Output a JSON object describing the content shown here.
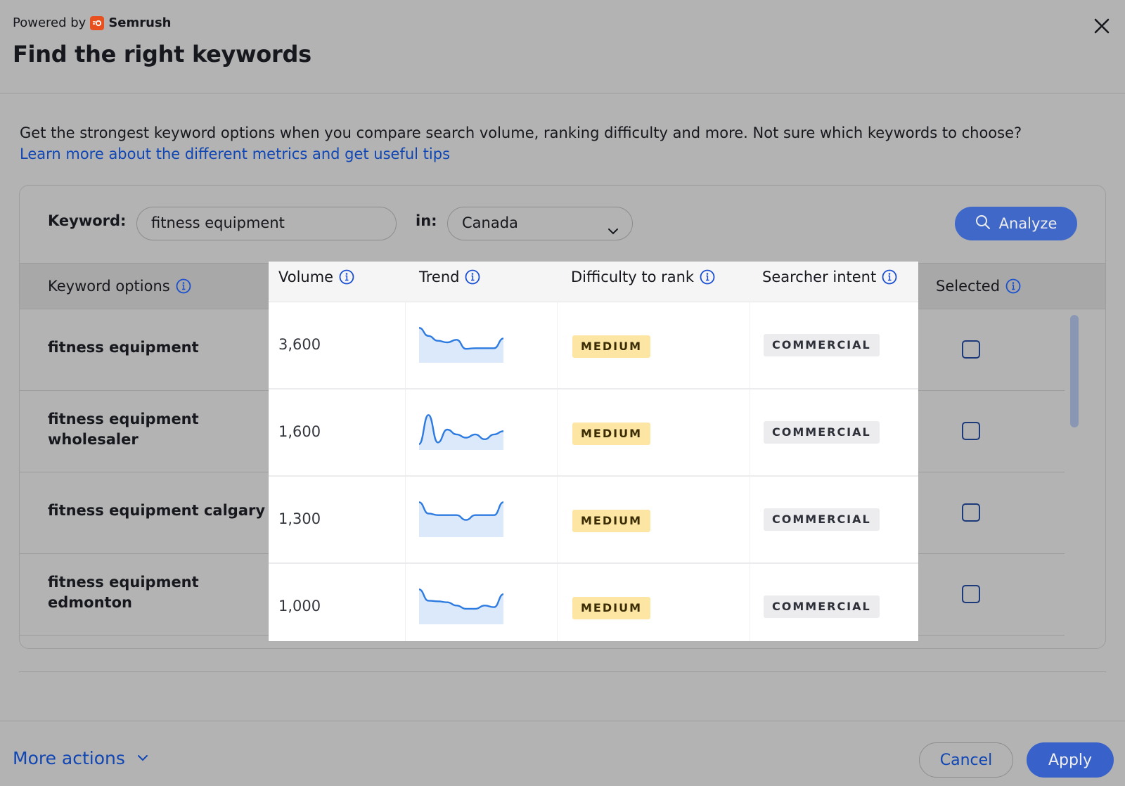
{
  "header": {
    "powered_by": "Powered by",
    "brand": "Semrush",
    "title": "Find the right keywords"
  },
  "intro": {
    "text": "Get the strongest keyword options when you compare search volume, ranking difficulty and more. Not sure which keywords to choose?",
    "link": "Learn more about the different metrics and get useful tips"
  },
  "search": {
    "keyword_label": "Keyword:",
    "keyword_value": "fitness equipment",
    "in_label": "in:",
    "country": "Canada",
    "analyze_label": "Analyze"
  },
  "columns": {
    "keyword_options": "Keyword options",
    "volume": "Volume",
    "trend": "Trend",
    "difficulty": "Difficulty to rank",
    "intent": "Searcher intent",
    "selected": "Selected"
  },
  "rows": [
    {
      "keyword": "fitness equipment",
      "volume": "3,600",
      "difficulty": "MEDIUM",
      "intent": "COMMERCIAL",
      "trend": [
        0.95,
        0.7,
        0.55,
        0.5,
        0.58,
        0.3,
        0.32,
        0.32,
        0.32,
        0.62
      ],
      "selected": false
    },
    {
      "keyword": "fitness equipment wholesaler",
      "volume": "1,600",
      "difficulty": "MEDIUM",
      "intent": "COMMERCIAL",
      "trend": [
        0.05,
        0.95,
        0.1,
        0.5,
        0.35,
        0.25,
        0.35,
        0.2,
        0.35,
        0.45
      ],
      "selected": false
    },
    {
      "keyword": "fitness equipment calgary",
      "volume": "1,300",
      "difficulty": "MEDIUM",
      "intent": "COMMERCIAL",
      "trend": [
        0.95,
        0.6,
        0.55,
        0.55,
        0.55,
        0.4,
        0.55,
        0.55,
        0.55,
        0.95
      ],
      "selected": false
    },
    {
      "keyword": "fitness equipment edmonton",
      "volume": "1,000",
      "difficulty": "MEDIUM",
      "intent": "COMMERCIAL",
      "trend": [
        0.95,
        0.6,
        0.58,
        0.55,
        0.45,
        0.35,
        0.35,
        0.45,
        0.4,
        0.8
      ],
      "selected": false
    }
  ],
  "footer": {
    "more_actions": "More actions",
    "cancel": "Cancel",
    "apply": "Apply"
  },
  "colors": {
    "accent": "#1a4fd0",
    "link": "#1046b4",
    "medium_badge": "#fde5a3",
    "commercial_badge": "#ececef",
    "trend_line": "#2d7be0"
  }
}
